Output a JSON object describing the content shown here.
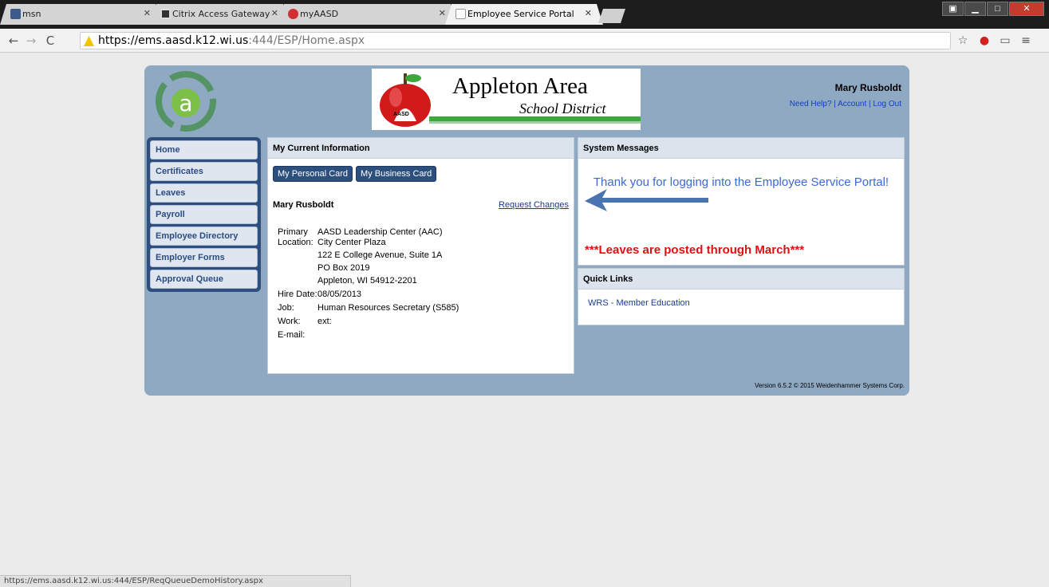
{
  "browser": {
    "tabs": [
      {
        "label": "msn",
        "icon": "msn-icon",
        "color": "#3c5a8c"
      },
      {
        "label": "Citrix Access Gateway",
        "icon": "citrix-icon",
        "color": "#333333"
      },
      {
        "label": "myAASD",
        "icon": "myaasd-icon",
        "color": "#d03030"
      },
      {
        "label": "Employee Service Portal",
        "icon": "page-icon",
        "color": "#ffffff",
        "active": true
      }
    ],
    "url_host": "https://ems.aasd.k12.wi.us",
    "url_rest": ":444/ESP/Home.aspx",
    "status_url": "https://ems.aasd.k12.wi.us:444/ESP/ReqQueueDemoHistory.aspx"
  },
  "header": {
    "logo_title": "Appleton Area",
    "logo_subtitle": "School District",
    "apple_badge": "AASD",
    "user_name": "Mary Rusboldt",
    "links": [
      "Need Help?",
      "Account",
      "Log Out"
    ]
  },
  "nav": {
    "items": [
      "Home",
      "Certificates",
      "Leaves",
      "Payroll",
      "Employee Directory",
      "Employer Forms",
      "Approval Queue"
    ]
  },
  "current_info": {
    "title": "My Current Information",
    "btn_personal": "My Personal Card",
    "btn_business": "My Business Card",
    "name": "Mary Rusboldt",
    "request_changes": "Request Changes",
    "rows": [
      {
        "label": "Primary",
        "value": "AASD Leadership Center (AAC)"
      },
      {
        "label": "Location:",
        "value": "City Center Plaza"
      },
      {
        "label": "",
        "value": "122 E College Avenue, Suite 1A"
      },
      {
        "label": "",
        "value": "PO Box 2019"
      },
      {
        "label": "",
        "value": "Appleton, WI 54912-2201"
      },
      {
        "label": "Hire Date:",
        "value": "08/05/2013"
      },
      {
        "label": "Job:",
        "value": "Human Resources Secretary (S585)"
      },
      {
        "label": "Work:",
        "value": "ext:"
      },
      {
        "label": "E-mail:",
        "value": ""
      }
    ]
  },
  "system_messages": {
    "title": "System Messages",
    "thanks": "Thank you for logging into the Employee Service Portal!",
    "leaves": "***Leaves are posted through March***"
  },
  "quick_links": {
    "title": "Quick Links",
    "items": [
      "WRS - Member Education"
    ]
  },
  "footer": {
    "version": "Version 6.5.2 © 2015 Weidenhammer Systems Corp."
  },
  "colors": {
    "frame": "#8fa9c3",
    "nav_bg": "#2e4f7d",
    "alert_red": "#e01010",
    "message_blue": "#3b69d6"
  }
}
